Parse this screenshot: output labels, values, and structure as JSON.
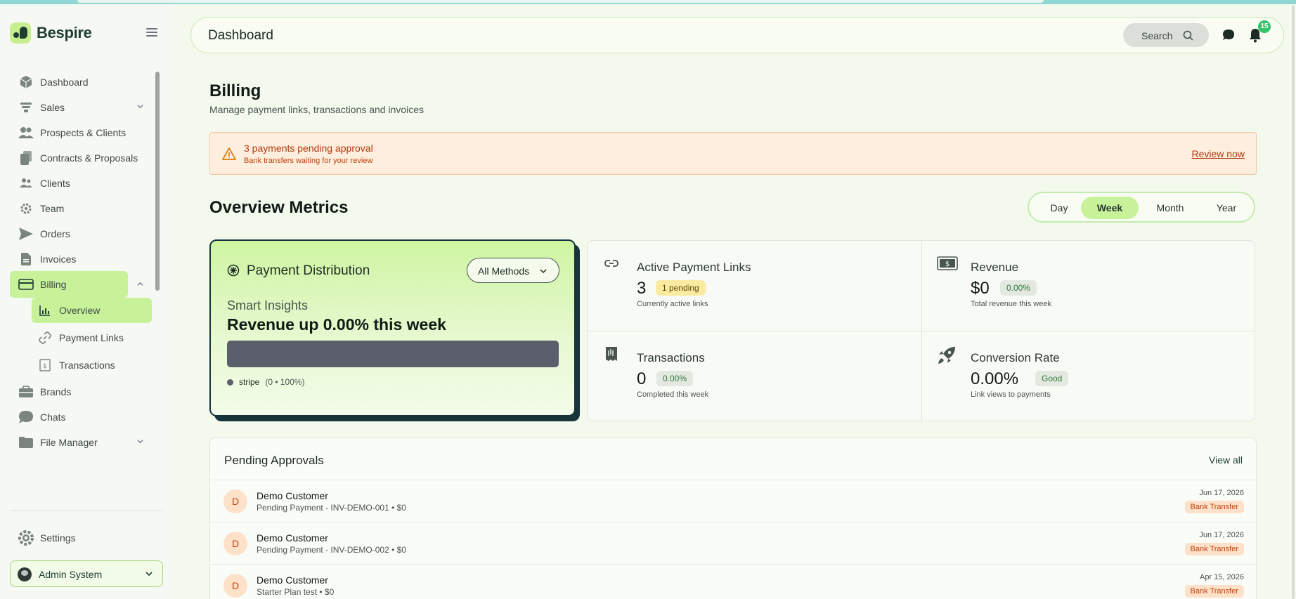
{
  "app": {
    "brand": "Bespire"
  },
  "header": {
    "title": "Dashboard",
    "search_label": "Search",
    "notification_count": "15"
  },
  "sidebar": {
    "items": [
      {
        "label": "Dashboard",
        "icon": "cube-icon"
      },
      {
        "label": "Sales",
        "icon": "funnel-icon",
        "expandable": true
      },
      {
        "label": "Prospects & Clients",
        "icon": "users-icon"
      },
      {
        "label": "Contracts & Proposals",
        "icon": "documents-icon"
      },
      {
        "label": "Clients",
        "icon": "user-group-icon"
      },
      {
        "label": "Team",
        "icon": "gear-icon"
      },
      {
        "label": "Orders",
        "icon": "send-icon"
      },
      {
        "label": "Invoices",
        "icon": "invoice-icon"
      },
      {
        "label": "Billing",
        "icon": "credit-card-icon",
        "expanded": true,
        "active": true
      },
      {
        "label": "Brands",
        "icon": "briefcase-icon"
      },
      {
        "label": "Chats",
        "icon": "chat-icon"
      },
      {
        "label": "File Manager",
        "icon": "folder-icon",
        "expandable": true
      }
    ],
    "billing_sub": [
      {
        "label": "Overview",
        "icon": "bar-chart-icon",
        "active": true
      },
      {
        "label": "Payment Links",
        "icon": "link-icon"
      },
      {
        "label": "Transactions",
        "icon": "receipt-icon"
      }
    ],
    "settings_label": "Settings",
    "user_label": "Admin System"
  },
  "page": {
    "title": "Billing",
    "subtitle": "Manage payment links, transactions and invoices"
  },
  "alert": {
    "title": "3 payments pending approval",
    "subtitle": "Bank transfers waiting for your review",
    "action": "Review now"
  },
  "overview": {
    "title": "Overview Metrics",
    "ranges": [
      "Day",
      "Week",
      "Month",
      "Year"
    ],
    "selected_range": "Week"
  },
  "distribution": {
    "title": "Payment Distribution",
    "filter": "All Methods",
    "insight_label": "Smart Insights",
    "insight_text": "Revenue up 0.00% this week",
    "legend_name": "stripe",
    "legend_values": "(0 • 100%)",
    "stripe_share": 1.0
  },
  "metrics": {
    "links": {
      "name": "Active Payment Links",
      "value": "3",
      "pill": "1 pending",
      "desc": "Currently active links"
    },
    "revenue": {
      "name": "Revenue",
      "value": "$0",
      "pill": "0.00%",
      "desc": "Total revenue this week"
    },
    "transactions": {
      "name": "Transactions",
      "value": "0",
      "pill": "0.00%",
      "desc": "Completed this week"
    },
    "conversion": {
      "name": "Conversion Rate",
      "value": "0.00%",
      "pill": "Good",
      "desc": "Link views to payments"
    }
  },
  "pending": {
    "title": "Pending Approvals",
    "view_all": "View all",
    "rows": [
      {
        "initial": "D",
        "name": "Demo Customer",
        "detail": "Pending Payment - INV-DEMO-001 • $0",
        "date": "Jun 17, 2026",
        "method": "Bank Transfer"
      },
      {
        "initial": "D",
        "name": "Demo Customer",
        "detail": "Pending Payment - INV-DEMO-002 • $0",
        "date": "Jun 17, 2026",
        "method": "Bank Transfer"
      },
      {
        "initial": "D",
        "name": "Demo Customer",
        "detail": "Starter Plan test • $0",
        "date": "Apr 15, 2026",
        "method": "Bank Transfer"
      }
    ]
  }
}
